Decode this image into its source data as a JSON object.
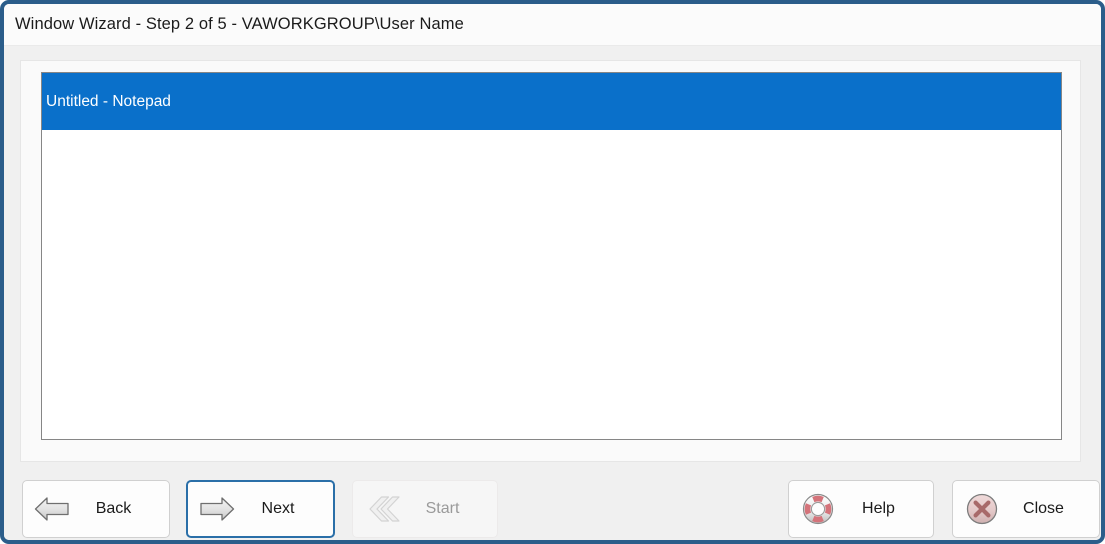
{
  "window": {
    "title": "Window Wizard - Step 2 of 5 - VAWORKGROUP\\User Name",
    "frame_color": "#2b5d8a",
    "titlebar_bg": "#fbfbfb",
    "client_bg": "#f0f0f0"
  },
  "list": {
    "selection_color": "#0a70ca",
    "items": [
      {
        "label": "Untitled - Notepad",
        "selected": true
      }
    ]
  },
  "buttons": {
    "back": {
      "label": "Back",
      "icon": "arrow-left-icon",
      "state": "enabled"
    },
    "next": {
      "label": "Next",
      "icon": "arrow-right-icon",
      "state": "focused"
    },
    "start": {
      "label": "Start",
      "icon": "double-chevron-left-icon",
      "state": "disabled"
    },
    "help": {
      "label": "Help",
      "icon": "life-ring-icon",
      "state": "enabled"
    },
    "close": {
      "label": "Close",
      "icon": "circle-x-icon",
      "state": "enabled"
    }
  },
  "colors": {
    "accent_blue": "#0a70ca",
    "focus_border": "#2a6fa8",
    "help_red": "#d4737a",
    "close_red": "#a86a6a",
    "disabled_text": "#9a9a9a"
  }
}
